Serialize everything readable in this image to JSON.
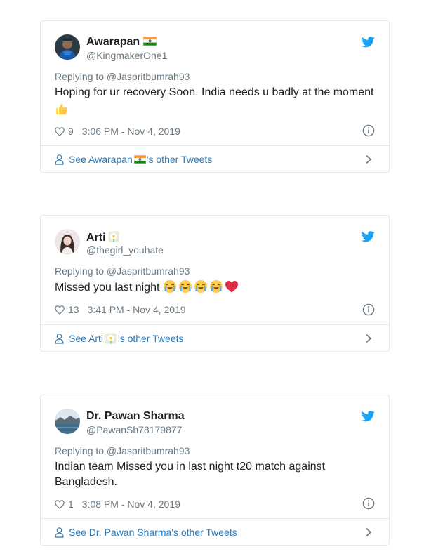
{
  "tweets": [
    {
      "name": "Awarapan",
      "handle": "@KingmakerOne1",
      "replying_to": "Replying to @Jaspritbumrah93",
      "text": "Hoping for ur recovery Soon. India needs u badly at the moment",
      "likes": "9",
      "timestamp": "3:06 PM - Nov 4, 2019",
      "see_prefix": "See Awarapan",
      "see_suffix": "'s other Tweets"
    },
    {
      "name": "Arti",
      "handle": "@thegirl_youhate",
      "replying_to": "Replying to @Jaspritbumrah93",
      "text": "Missed you last night",
      "likes": "13",
      "timestamp": "3:41 PM - Nov 4, 2019",
      "see_prefix": "See Arti",
      "see_suffix": "'s other Tweets"
    },
    {
      "name": "Dr. Pawan Sharma",
      "handle": "@PawanSh78179877",
      "replying_to": "Replying to @Jaspritbumrah93",
      "text": "Indian team Missed you in last night t20 match against Bangladesh.",
      "likes": "1",
      "timestamp": "3:08 PM - Nov 4, 2019",
      "see_prefix": "See Dr. Pawan Sharma",
      "see_suffix": "'s other Tweets"
    }
  ],
  "colors": {
    "twitter_blue": "#1da1f2",
    "link_blue": "#2b7bb9",
    "secondary_text": "#697882",
    "border": "#e1e8ed"
  },
  "icons": [
    "twitter-bird-icon",
    "heart-icon",
    "info-icon",
    "person-icon",
    "chevron-right-icon",
    "india-flag-icon",
    "thumbs-up-emoji",
    "crying-face-emoji",
    "red-heart-emoji",
    "flower-emoji"
  ]
}
